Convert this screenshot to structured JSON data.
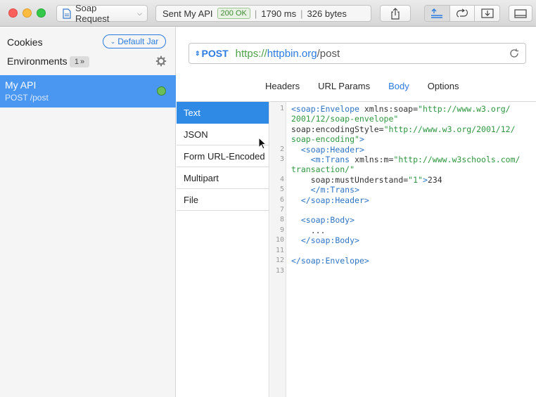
{
  "toolbar": {
    "request_name": "Soap Request",
    "status_prefix": "Sent My API",
    "status_code": "200 OK",
    "status_time": "1790 ms",
    "status_size": "326 bytes"
  },
  "sidebar": {
    "cookies_label": "Cookies",
    "jar_label": "Default Jar",
    "environments_label": "Environments",
    "environments_count": "1",
    "item": {
      "name": "My API",
      "subtitle": "POST /post"
    }
  },
  "request": {
    "method": "POST",
    "url_scheme": "https://",
    "url_host": "httpbin.org",
    "url_path": "/post"
  },
  "tabs": [
    "Headers",
    "URL Params",
    "Body",
    "Options"
  ],
  "active_tab": "Body",
  "body_types": [
    "Text",
    "JSON",
    "Form URL-Encoded",
    "Multipart",
    "File"
  ],
  "active_body_type": "Text",
  "code_lines": [
    {
      "n": "1",
      "parts": [
        [
          "tag",
          "<soap:Envelope"
        ],
        [
          "txt",
          " xmlns:soap="
        ],
        [
          "str",
          "\"http://www.w3.org/"
        ]
      ]
    },
    {
      "n": "",
      "parts": [
        [
          "str",
          "2001/12/soap-envelope\""
        ]
      ]
    },
    {
      "n": "",
      "parts": [
        [
          "txt",
          "soap:encodingStyle="
        ],
        [
          "str",
          "\"http://www.w3.org/2001/12/"
        ]
      ]
    },
    {
      "n": "",
      "parts": [
        [
          "str",
          "soap-encoding\""
        ],
        [
          "tag",
          ">"
        ]
      ]
    },
    {
      "n": "2",
      "parts": [
        [
          "txt",
          "  "
        ],
        [
          "tag",
          "<soap:Header>"
        ]
      ]
    },
    {
      "n": "3",
      "parts": [
        [
          "txt",
          "    "
        ],
        [
          "tag",
          "<m:Trans"
        ],
        [
          "txt",
          " xmlns:m="
        ],
        [
          "str",
          "\"http://www.w3schools.com/"
        ]
      ]
    },
    {
      "n": "",
      "parts": [
        [
          "str",
          "transaction/\""
        ]
      ]
    },
    {
      "n": "4",
      "parts": [
        [
          "txt",
          "    soap:mustUnderstand="
        ],
        [
          "str",
          "\"1\""
        ],
        [
          "tag",
          ">"
        ],
        [
          "txt",
          "234"
        ]
      ]
    },
    {
      "n": "5",
      "parts": [
        [
          "txt",
          "    "
        ],
        [
          "tag",
          "</m:Trans>"
        ]
      ]
    },
    {
      "n": "6",
      "parts": [
        [
          "txt",
          "  "
        ],
        [
          "tag",
          "</soap:Header>"
        ]
      ]
    },
    {
      "n": "7",
      "parts": [
        [
          "txt",
          ""
        ]
      ]
    },
    {
      "n": "8",
      "parts": [
        [
          "txt",
          "  "
        ],
        [
          "tag",
          "<soap:Body>"
        ]
      ]
    },
    {
      "n": "9",
      "parts": [
        [
          "txt",
          "    ..."
        ]
      ]
    },
    {
      "n": "10",
      "parts": [
        [
          "txt",
          "  "
        ],
        [
          "tag",
          "</soap:Body>"
        ]
      ]
    },
    {
      "n": "11",
      "parts": [
        [
          "txt",
          ""
        ]
      ]
    },
    {
      "n": "12",
      "parts": [
        [
          "tag",
          "</soap:Envelope>"
        ]
      ]
    },
    {
      "n": "13",
      "parts": [
        [
          "txt",
          ""
        ]
      ]
    }
  ],
  "icons": {
    "request_type": "document-icon",
    "share": "share-icon",
    "panel": "sidebar-panel-icon"
  },
  "colors": {
    "accent": "#2b7be0",
    "selected_bg": "#4a97f2",
    "status_green": "#3f8a33"
  }
}
